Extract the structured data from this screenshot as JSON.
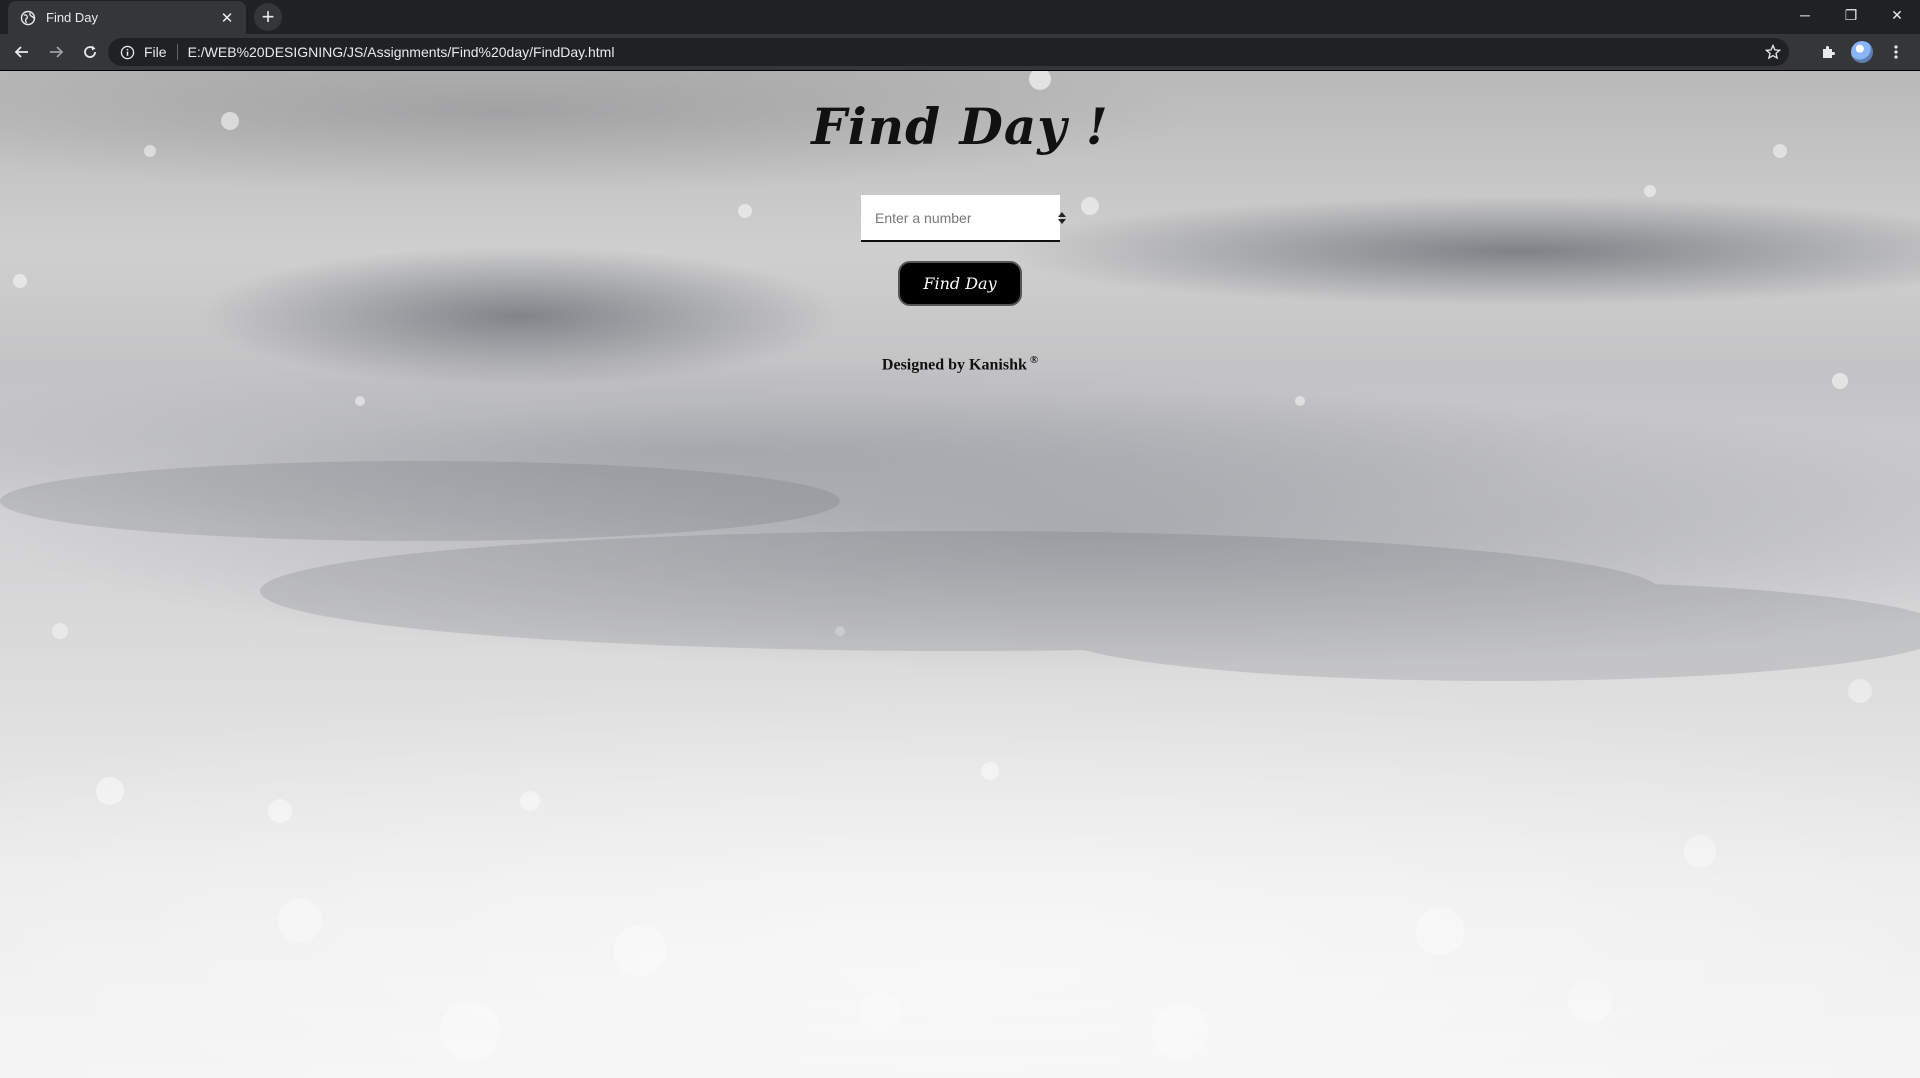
{
  "browser": {
    "tab": {
      "title": "Find Day",
      "close_glyph": "✕",
      "favicon": "globe-icon"
    },
    "new_tab_glyph": "+",
    "window_controls": {
      "minimize": "─",
      "restore": "❐",
      "close": "✕"
    },
    "address": {
      "scheme_label": "File",
      "url": "E:/WEB%20DESIGNING/JS/Assignments/Find%20day/FindDay.html"
    }
  },
  "page": {
    "title": "Find Day !",
    "number_input": {
      "placeholder": "Enter a number",
      "value": ""
    },
    "find_button_label": "Find Day",
    "credit": {
      "text": "Designed by Kanishk",
      "mark": "®"
    }
  },
  "colors": {
    "chrome_dark": "#202124",
    "chrome_bar": "#35363a",
    "button_bg": "#000000",
    "text_dark": "#111111"
  }
}
